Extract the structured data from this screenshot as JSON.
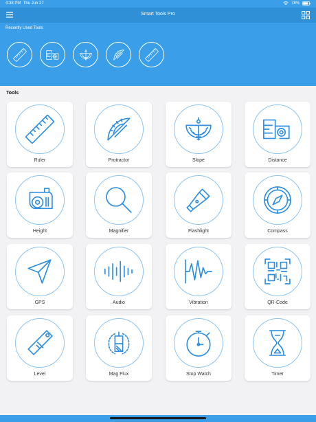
{
  "status": {
    "time": "4:38 PM",
    "date": "Thu Jun 27",
    "battery": "78%"
  },
  "header": {
    "title": "Smart Tools Pro"
  },
  "recent": {
    "label": "Recently Used Tools",
    "items": [
      "ruler",
      "distance",
      "slope",
      "protractor",
      "ruler"
    ]
  },
  "tools": {
    "label": "Tools",
    "items": [
      {
        "label": "Ruler",
        "icon": "ruler-icon"
      },
      {
        "label": "Protractor",
        "icon": "protractor-icon"
      },
      {
        "label": "Slope",
        "icon": "slope-icon"
      },
      {
        "label": "Distance",
        "icon": "distance-icon"
      },
      {
        "label": "Height",
        "icon": "tape-measure-icon"
      },
      {
        "label": "Magnifier",
        "icon": "magnifier-icon"
      },
      {
        "label": "Flashlight",
        "icon": "flashlight-icon"
      },
      {
        "label": "Compass",
        "icon": "compass-icon"
      },
      {
        "label": "GPS",
        "icon": "gps-icon"
      },
      {
        "label": "Audio",
        "icon": "audio-icon"
      },
      {
        "label": "Vibration",
        "icon": "vibration-icon"
      },
      {
        "label": "QR-Code",
        "icon": "qr-code-icon"
      },
      {
        "label": "Level",
        "icon": "level-icon"
      },
      {
        "label": "Mag Flux",
        "icon": "magnet-icon"
      },
      {
        "label": "Stop Watch",
        "icon": "stopwatch-icon"
      },
      {
        "label": "Timer",
        "icon": "hourglass-icon"
      }
    ]
  },
  "colors": {
    "accent": "#3a9fe8",
    "icon": "#2f8fe0"
  }
}
